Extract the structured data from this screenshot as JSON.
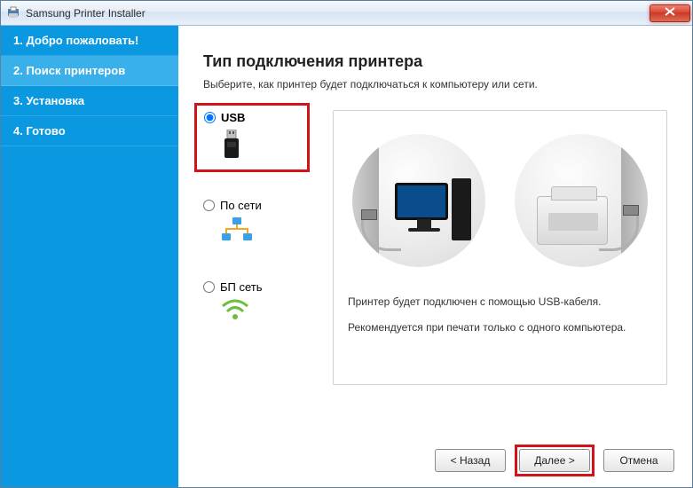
{
  "window": {
    "title": "Samsung Printer Installer"
  },
  "sidebar": {
    "steps": [
      "1. Добро пожаловать!",
      "2. Поиск принтеров",
      "3. Установка",
      "4. Готово"
    ]
  },
  "main": {
    "heading": "Тип подключения принтера",
    "subtext": "Выберите, как принтер будет подключаться к компьютеру или сети.",
    "options": {
      "usb": "USB",
      "network": "По сети",
      "wireless": "БП сеть"
    },
    "detail": {
      "line1": "Принтер будет подключен с помощью USB-кабеля.",
      "line2": "Рекомендуется при печати только с одного компьютера."
    }
  },
  "footer": {
    "back": "< Назад",
    "next": "Далее >",
    "cancel": "Отмена"
  }
}
